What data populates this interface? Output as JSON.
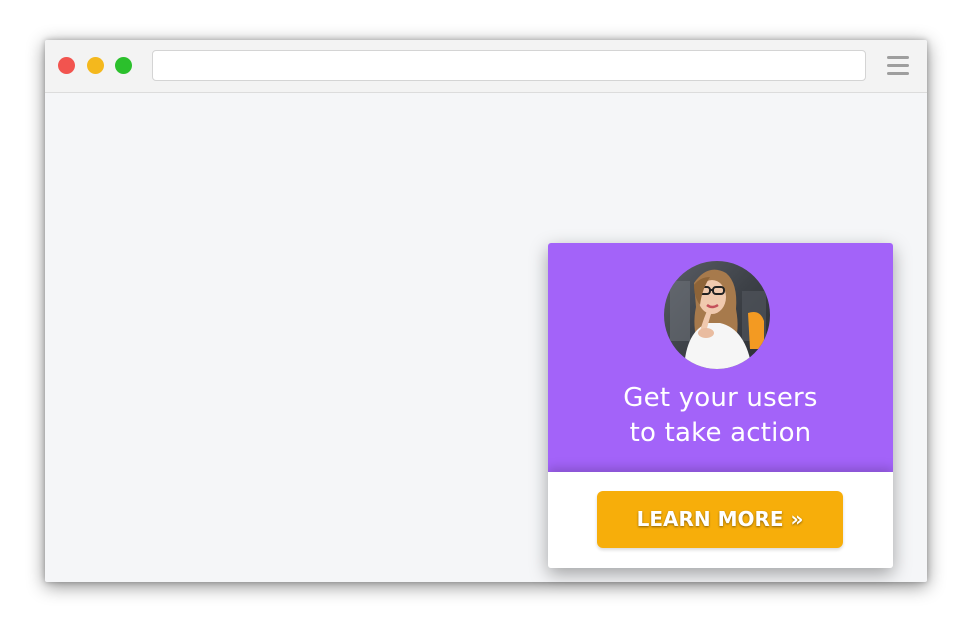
{
  "browser": {
    "url": "",
    "colors": {
      "close": "#f2544f",
      "minimize": "#f4b81d",
      "maximize": "#2bc02c"
    },
    "menu_icon": "hamburger-menu-icon"
  },
  "popup": {
    "headline_line1": "Get your users",
    "headline_line2": "to take action",
    "cta_label": "LEARN MORE »",
    "colors": {
      "header_background": "#a363f9",
      "button_background": "#f7ae0a"
    }
  }
}
